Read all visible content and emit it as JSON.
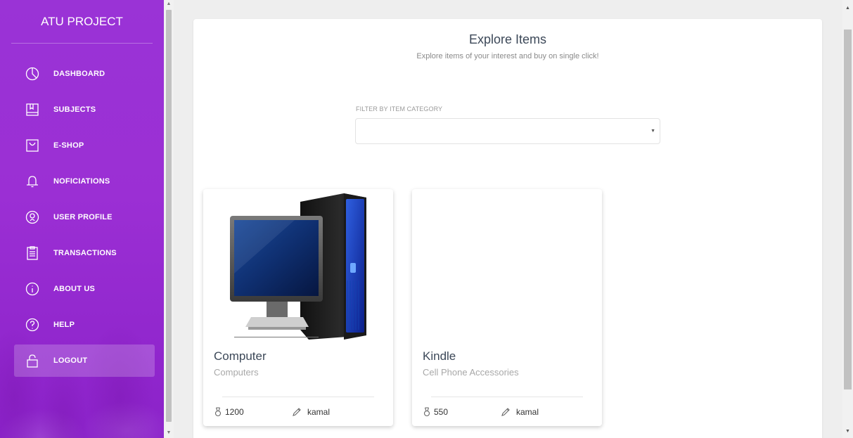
{
  "sidebar": {
    "brand": "ATU PROJECT",
    "items": [
      {
        "label": "DASHBOARD",
        "icon": "pie-chart-icon"
      },
      {
        "label": "SUBJECTS",
        "icon": "book-icon"
      },
      {
        "label": "E-SHOP",
        "icon": "shopping-bag-icon"
      },
      {
        "label": "NOFICIATIONS",
        "icon": "bell-icon"
      },
      {
        "label": "USER PROFILE",
        "icon": "user-circle-icon"
      },
      {
        "label": "TRANSACTIONS",
        "icon": "clipboard-icon"
      },
      {
        "label": "ABOUT US",
        "icon": "info-icon"
      },
      {
        "label": "HELP",
        "icon": "question-icon"
      },
      {
        "label": "LOGOUT",
        "icon": "lock-icon",
        "active": true
      }
    ]
  },
  "main": {
    "title": "Explore Items",
    "subtitle": "Explore items of your interest and buy on single click!",
    "filter": {
      "label": "FILTER BY ITEM CATEGORY",
      "selected": ""
    },
    "cards": [
      {
        "title": "Computer",
        "category": "Computers",
        "price": "1200",
        "seller": "kamal",
        "image": "computer-image"
      },
      {
        "title": "Kindle",
        "category": "Cell Phone Accessories",
        "price": "550",
        "seller": "kamal",
        "image": ""
      }
    ]
  },
  "colors": {
    "sidebar": "#9b2fd4",
    "active_item": "rgba(255,255,255,0.2)"
  }
}
